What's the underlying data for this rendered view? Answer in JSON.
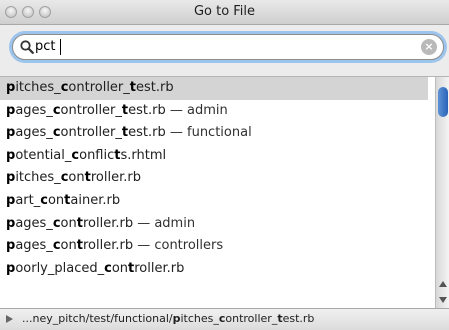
{
  "window": {
    "title": "Go to File"
  },
  "search": {
    "value": "pct"
  },
  "results": [
    {
      "segments": [
        {
          "t": "p",
          "b": true
        },
        {
          "t": "itches_",
          "b": false
        },
        {
          "t": "c",
          "b": true
        },
        {
          "t": "ontroller_",
          "b": false
        },
        {
          "t": "t",
          "b": true
        },
        {
          "t": "est.rb",
          "b": false
        }
      ],
      "context": ""
    },
    {
      "segments": [
        {
          "t": "p",
          "b": true
        },
        {
          "t": "ages_",
          "b": false
        },
        {
          "t": "c",
          "b": true
        },
        {
          "t": "ontroller_",
          "b": false
        },
        {
          "t": "t",
          "b": true
        },
        {
          "t": "est.rb",
          "b": false
        }
      ],
      "context": " — admin"
    },
    {
      "segments": [
        {
          "t": "p",
          "b": true
        },
        {
          "t": "ages_",
          "b": false
        },
        {
          "t": "c",
          "b": true
        },
        {
          "t": "ontroller_",
          "b": false
        },
        {
          "t": "t",
          "b": true
        },
        {
          "t": "est.rb",
          "b": false
        }
      ],
      "context": " — functional"
    },
    {
      "segments": [
        {
          "t": "p",
          "b": true
        },
        {
          "t": "otential_",
          "b": false
        },
        {
          "t": "c",
          "b": true
        },
        {
          "t": "onflic",
          "b": false
        },
        {
          "t": "t",
          "b": true
        },
        {
          "t": "s.rhtml",
          "b": false
        }
      ],
      "context": ""
    },
    {
      "segments": [
        {
          "t": "p",
          "b": true
        },
        {
          "t": "itches_",
          "b": false
        },
        {
          "t": "c",
          "b": true
        },
        {
          "t": "on",
          "b": false
        },
        {
          "t": "t",
          "b": true
        },
        {
          "t": "roller.rb",
          "b": false
        }
      ],
      "context": ""
    },
    {
      "segments": [
        {
          "t": "p",
          "b": true
        },
        {
          "t": "art_",
          "b": false
        },
        {
          "t": "c",
          "b": true
        },
        {
          "t": "on",
          "b": false
        },
        {
          "t": "t",
          "b": true
        },
        {
          "t": "ainer.rb",
          "b": false
        }
      ],
      "context": ""
    },
    {
      "segments": [
        {
          "t": "p",
          "b": true
        },
        {
          "t": "ages_",
          "b": false
        },
        {
          "t": "c",
          "b": true
        },
        {
          "t": "on",
          "b": false
        },
        {
          "t": "t",
          "b": true
        },
        {
          "t": "roller.rb",
          "b": false
        }
      ],
      "context": " — admin"
    },
    {
      "segments": [
        {
          "t": "p",
          "b": true
        },
        {
          "t": "ages_",
          "b": false
        },
        {
          "t": "c",
          "b": true
        },
        {
          "t": "on",
          "b": false
        },
        {
          "t": "t",
          "b": true
        },
        {
          "t": "roller.rb",
          "b": false
        }
      ],
      "context": " — controllers"
    },
    {
      "segments": [
        {
          "t": "p",
          "b": true
        },
        {
          "t": "oorly_placed_",
          "b": false
        },
        {
          "t": "c",
          "b": true
        },
        {
          "t": "on",
          "b": false
        },
        {
          "t": "t",
          "b": true
        },
        {
          "t": "roller.rb",
          "b": false
        }
      ],
      "context": ""
    }
  ],
  "selected_index": 0,
  "pathbar": {
    "segments": [
      {
        "t": "...ney_pitch/test/functional/",
        "b": false
      },
      {
        "t": "p",
        "b": true
      },
      {
        "t": "itches_",
        "b": false
      },
      {
        "t": "c",
        "b": true
      },
      {
        "t": "ontroller_",
        "b": false
      },
      {
        "t": "t",
        "b": true
      },
      {
        "t": "est.rb",
        "b": false
      }
    ]
  },
  "icons": {
    "search": "magnifier-icon",
    "clear": "clear-search-icon",
    "disclosure": "disclosure-triangle-icon"
  }
}
